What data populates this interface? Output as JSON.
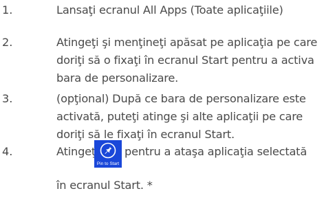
{
  "steps": [
    {
      "number": "1.",
      "lines": [
        "Lansaţi ecranul All Apps (Toate aplicaţiile)"
      ]
    },
    {
      "number": "2.",
      "lines": [
        "Atingeţi şi menţineţi apăsat pe aplicaţia pe care",
        "doriţi să o fixaţi în ecranul Start pentru a activa",
        "bara de personalizare."
      ]
    },
    {
      "number": "3.",
      "lines": [
        "(opţional) După ce bara de personalizare este",
        "activată, puteţi atinge şi alte aplicaţii pe care",
        "doriţi să le fixaţi în ecranul Start."
      ]
    },
    {
      "number": "4.",
      "before_icon": "Atingeţi",
      "after_icon": "pentru a ataşa aplicaţia selectată",
      "line2": "în ecranul Start. *",
      "icon": {
        "name": "pin-icon",
        "label": "Pin to Start",
        "color": "#1a47d9"
      }
    }
  ]
}
